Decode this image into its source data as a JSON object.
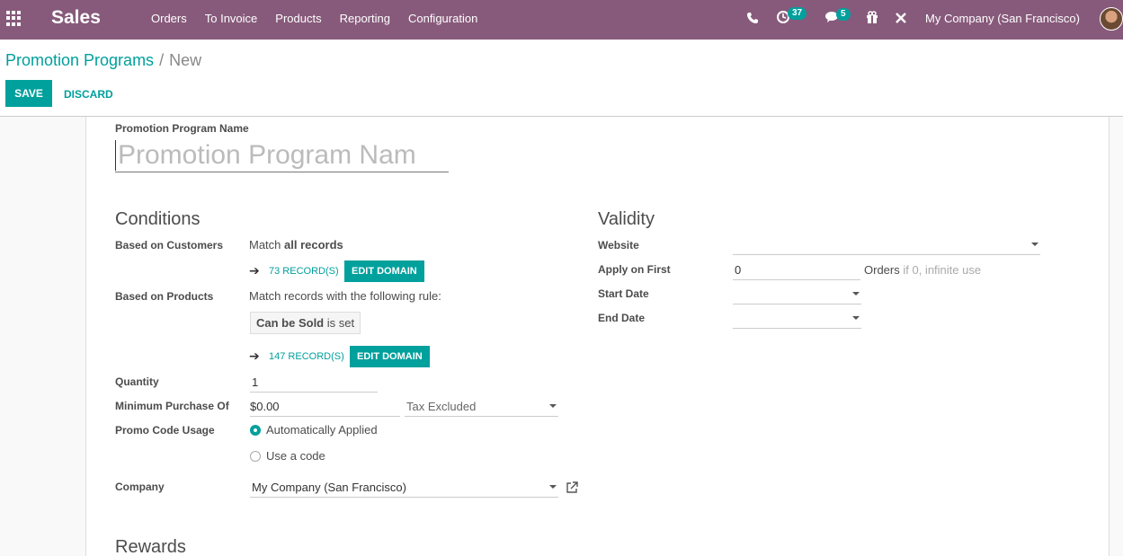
{
  "navbar": {
    "brand": "Sales",
    "menu": [
      "Orders",
      "To Invoice",
      "Products",
      "Reporting",
      "Configuration"
    ],
    "activity_count": "37",
    "message_count": "5",
    "company": "My Company (San Francisco)"
  },
  "breadcrumb": {
    "parent": "Promotion Programs",
    "separator": "/",
    "current": "New"
  },
  "actions": {
    "save": "SAVE",
    "discard": "DISCARD"
  },
  "form": {
    "name_label": "Promotion Program Name",
    "name_placeholder": "Promotion Program Nam",
    "conditions": {
      "title": "Conditions",
      "customers_label": "Based on Customers",
      "customers_match_prefix": "Match ",
      "customers_match_bold": "all records",
      "customers_records": "73 RECORD(S)",
      "customers_edit": "EDIT DOMAIN",
      "products_label": "Based on Products",
      "products_rule": "Match records with the following rule:",
      "rule_field": "Can be Sold",
      "rule_op": "is set",
      "products_records": "147 RECORD(S)",
      "products_edit": "EDIT DOMAIN",
      "quantity_label": "Quantity",
      "quantity_value": "1",
      "min_purchase_label": "Minimum Purchase Of",
      "min_purchase_value": "$0.00",
      "tax_mode": "Tax Excluded",
      "promo_usage_label": "Promo Code Usage",
      "promo_option_auto": "Automatically Applied",
      "promo_option_code": "Use a code",
      "company_label": "Company",
      "company_value": "My Company (San Francisco)"
    },
    "validity": {
      "title": "Validity",
      "website_label": "Website",
      "website_value": "",
      "apply_first_label": "Apply on First",
      "apply_first_value": "0",
      "apply_first_suffix": "Orders",
      "apply_first_hint": "if 0, infinite use",
      "start_date_label": "Start Date",
      "end_date_label": "End Date"
    },
    "rewards_title": "Rewards"
  },
  "colors": {
    "navbar": "#875a7b",
    "accent": "#00a09d"
  }
}
